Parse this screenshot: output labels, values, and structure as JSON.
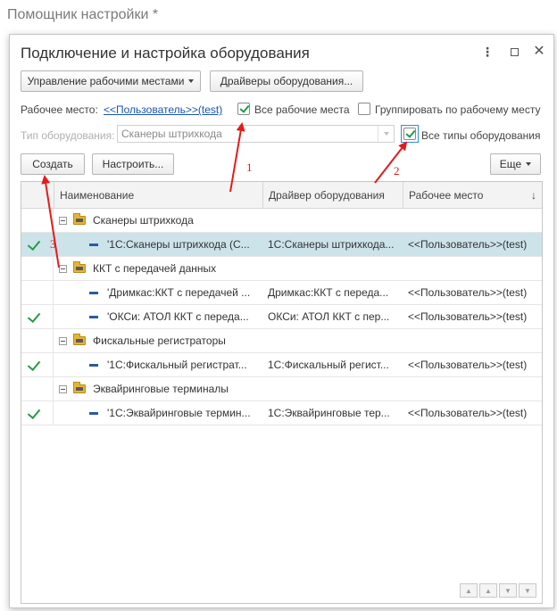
{
  "background": {
    "title": "Помощник настройки *"
  },
  "dialog": {
    "title": "Подключение и настройка оборудования",
    "more_glyph": "⋮",
    "close_glyph": "✕"
  },
  "toolbar": {
    "workplaces_button": "Управление рабочими местами",
    "drivers_button": "Драйверы оборудования..."
  },
  "filters": {
    "workplace_label": "Рабочее место:",
    "workplace_value": "<<Пользователь>>(test)",
    "all_workplaces": {
      "label": "Все рабочие места",
      "checked": true
    },
    "group_by_workplace": {
      "label": "Группировать по рабочему месту",
      "checked": false
    },
    "equipment_type_label": "Тип оборудования:",
    "equipment_type_value": "Сканеры штрихкода",
    "all_types": {
      "label": "Все типы оборудования",
      "checked": true
    }
  },
  "actions": {
    "create_button": "Создать",
    "configure_button": "Настроить...",
    "more_button": "Еще"
  },
  "table": {
    "columns": [
      "Наименование",
      "Драйвер оборудования",
      "Рабочее место"
    ],
    "sort_indicator": "↓",
    "rows": [
      {
        "type": "group",
        "name": "Сканеры штрихкода",
        "driver": "",
        "workplace": "",
        "checked": false,
        "selected": false
      },
      {
        "type": "item",
        "name": "'1С:Сканеры штрихкода (С...",
        "driver": "1С:Сканеры штрихкода...",
        "workplace": "<<Пользователь>>(test)",
        "checked": true,
        "selected": true
      },
      {
        "type": "group",
        "name": "ККТ с передачей данных",
        "driver": "",
        "workplace": "",
        "checked": false,
        "selected": false
      },
      {
        "type": "item",
        "name": "'Дримкас:ККТ с передачей ...",
        "driver": "Дримкас:ККТ с переда...",
        "workplace": "<<Пользователь>>(test)",
        "checked": false,
        "selected": false
      },
      {
        "type": "item",
        "name": "'ОКСи: АТОЛ ККТ с переда...",
        "driver": "ОКСи: АТОЛ ККТ с пер...",
        "workplace": "<<Пользователь>>(test)",
        "checked": true,
        "selected": false
      },
      {
        "type": "group",
        "name": "Фискальные регистраторы",
        "driver": "",
        "workplace": "",
        "checked": false,
        "selected": false
      },
      {
        "type": "item",
        "name": "'1С:Фискальный регистрат...",
        "driver": "1С:Фискальный регист...",
        "workplace": "<<Пользователь>>(test)",
        "checked": true,
        "selected": false
      },
      {
        "type": "group",
        "name": "Эквайринговые терминалы",
        "driver": "",
        "workplace": "",
        "checked": false,
        "selected": false
      },
      {
        "type": "item",
        "name": "'1С:Эквайринговые термин...",
        "driver": "1С:Эквайринговые тер...",
        "workplace": "<<Пользователь>>(test)",
        "checked": true,
        "selected": false
      }
    ],
    "nav_icons": [
      "first-icon",
      "up-icon",
      "down-icon",
      "last-icon"
    ]
  },
  "annotations": {
    "labels": [
      "1",
      "2",
      "3"
    ],
    "color": "#e31b1b"
  },
  "colors": {
    "selected_row": "#cce3ea",
    "check_green": "#2a9a4a",
    "link_blue": "#1a55b0",
    "focus_blue": "#2f8fd8"
  }
}
